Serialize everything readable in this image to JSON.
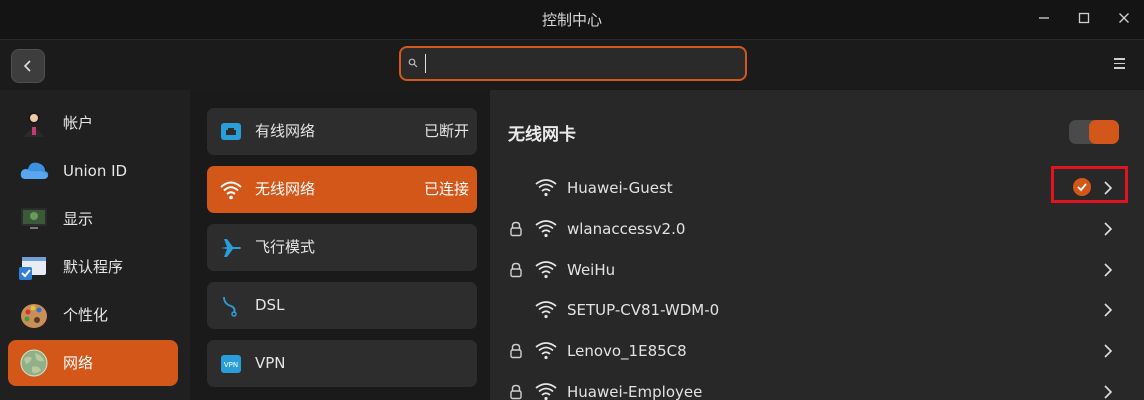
{
  "window": {
    "title": "控制中心",
    "controls": [
      "minimize-icon",
      "maximize-icon",
      "close-icon"
    ]
  },
  "toolbar": {
    "back_icon": "chevron-left-icon",
    "search_icon": "search-icon",
    "search_value": "",
    "menu_icon": "hamburger-menu-icon"
  },
  "sidebar": {
    "items": [
      {
        "label": "帐户",
        "icon": "account-icon",
        "active": false
      },
      {
        "label": "Union ID",
        "icon": "cloud-icon",
        "active": false
      },
      {
        "label": "显示",
        "icon": "display-icon",
        "active": false
      },
      {
        "label": "默认程序",
        "icon": "default-apps-icon",
        "active": false
      },
      {
        "label": "个性化",
        "icon": "palette-icon",
        "active": false
      },
      {
        "label": "网络",
        "icon": "network-globe-icon",
        "active": true
      }
    ]
  },
  "network_menu": {
    "items": [
      {
        "label": "有线网络",
        "status": "已断开",
        "icon": "wired-icon",
        "active": false
      },
      {
        "label": "无线网络",
        "status": "已连接",
        "icon": "wifi-icon",
        "active": true
      },
      {
        "label": "飞行模式",
        "status": "",
        "icon": "airplane-icon",
        "active": false
      },
      {
        "label": "DSL",
        "status": "",
        "icon": "dsl-icon",
        "active": false
      },
      {
        "label": "VPN",
        "status": "",
        "icon": "vpn-icon",
        "active": false
      }
    ]
  },
  "wireless": {
    "title": "无线网卡",
    "enabled": true,
    "networks": [
      {
        "ssid": "Huawei-Guest",
        "locked": false,
        "connected": true
      },
      {
        "ssid": "wlanaccessv2.0",
        "locked": true,
        "connected": false
      },
      {
        "ssid": "WeiHu",
        "locked": true,
        "connected": false
      },
      {
        "ssid": "SETUP-CV81-WDM-0",
        "locked": false,
        "connected": false
      },
      {
        "ssid": "Lenovo_1E85C8",
        "locked": true,
        "connected": false
      },
      {
        "ssid": "Huawei-Employee",
        "locked": true,
        "connected": false
      }
    ]
  },
  "colors": {
    "accent": "#d4571a",
    "highlight_box": "#e0141e"
  }
}
